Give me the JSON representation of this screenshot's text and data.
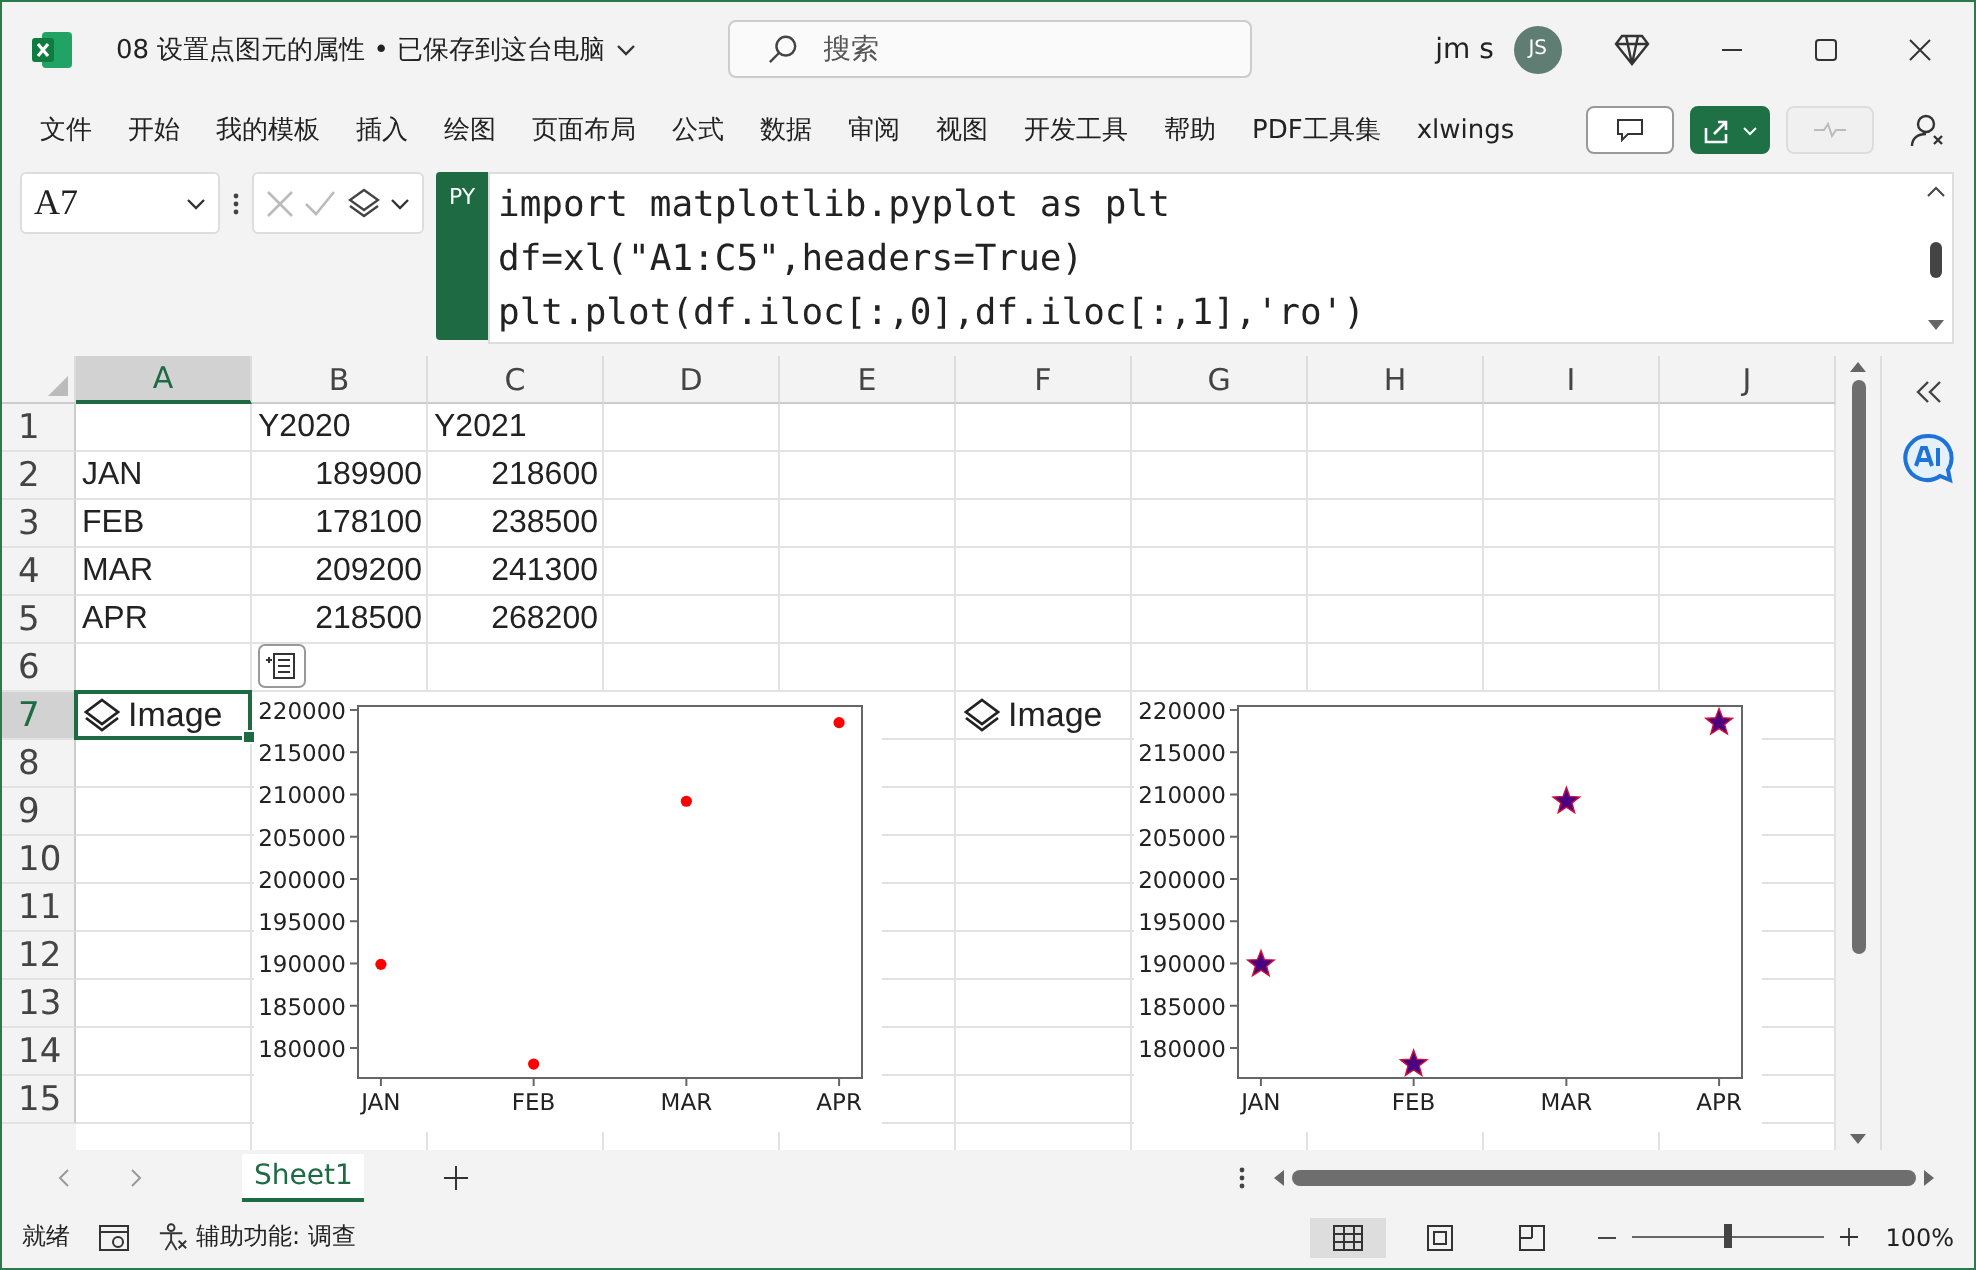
{
  "window": {
    "title": "08 设置点图元的属性 • 已保存到这台电脑",
    "search": {
      "placeholder": "搜索"
    },
    "user": "jm s",
    "avatar": "JS"
  },
  "ribbon_tabs": [
    "文件",
    "开始",
    "我的模板",
    "插入",
    "绘图",
    "页面布局",
    "公式",
    "数据",
    "审阅",
    "视图",
    "开发工具",
    "帮助",
    "PDF工具集",
    "xlwings"
  ],
  "name_box": "A7",
  "formula": {
    "badge": "PY",
    "lines": [
      "import matplotlib.pyplot as plt",
      "df=xl(\"A1:C5\",headers=True)",
      "plt.plot(df.iloc[:,0],df.iloc[:,1],'ro')"
    ]
  },
  "sheet": {
    "columns": [
      {
        "label": "A",
        "selected": true
      },
      {
        "label": "B",
        "selected": false
      },
      {
        "label": "C",
        "selected": false
      },
      {
        "label": "D",
        "selected": false
      },
      {
        "label": "E",
        "selected": false
      },
      {
        "label": "F",
        "selected": false
      },
      {
        "label": "G",
        "selected": false
      },
      {
        "label": "H",
        "selected": false
      },
      {
        "label": "I",
        "selected": false
      },
      {
        "label": "J",
        "selected": false
      }
    ],
    "rows": [
      {
        "header": "1",
        "selected": false,
        "cells": [
          {
            "kind": "empty"
          },
          {
            "kind": "text",
            "text": "Y2020"
          },
          {
            "kind": "text",
            "text": "Y2021"
          }
        ]
      },
      {
        "header": "2",
        "selected": false,
        "cells": [
          {
            "kind": "text",
            "text": "JAN"
          },
          {
            "kind": "number",
            "text": "189900"
          },
          {
            "kind": "number",
            "text": "218600"
          }
        ]
      },
      {
        "header": "3",
        "selected": false,
        "cells": [
          {
            "kind": "text",
            "text": "FEB"
          },
          {
            "kind": "number",
            "text": "178100"
          },
          {
            "kind": "number",
            "text": "238500"
          }
        ]
      },
      {
        "header": "4",
        "selected": false,
        "cells": [
          {
            "kind": "text",
            "text": "MAR"
          },
          {
            "kind": "number",
            "text": "209200"
          },
          {
            "kind": "number",
            "text": "241300"
          }
        ]
      },
      {
        "header": "5",
        "selected": false,
        "cells": [
          {
            "kind": "text",
            "text": "APR"
          },
          {
            "kind": "number",
            "text": "218500"
          },
          {
            "kind": "number",
            "text": "268200"
          }
        ]
      },
      {
        "header": "6",
        "selected": false,
        "cells": [
          {
            "kind": "empty"
          },
          {
            "kind": "card-icon"
          }
        ]
      },
      {
        "header": "7",
        "selected": true,
        "cells": [
          {
            "kind": "image-label",
            "text": "Image",
            "selected": true
          },
          {
            "kind": "empty"
          },
          {
            "kind": "empty"
          },
          {
            "kind": "empty"
          },
          {
            "kind": "empty"
          },
          {
            "kind": "image-label",
            "text": "Image",
            "selected": false
          }
        ]
      },
      {
        "header": "8",
        "selected": false,
        "cells": []
      },
      {
        "header": "9",
        "selected": false,
        "cells": []
      },
      {
        "header": "10",
        "selected": false,
        "cells": []
      },
      {
        "header": "11",
        "selected": false,
        "cells": []
      },
      {
        "header": "12",
        "selected": false,
        "cells": []
      },
      {
        "header": "13",
        "selected": false,
        "cells": []
      },
      {
        "header": "14",
        "selected": false,
        "cells": []
      },
      {
        "header": "15",
        "selected": false,
        "cells": []
      }
    ],
    "images": [
      {
        "chart_data": {
          "type": "scatter",
          "categories": [
            "JAN",
            "FEB",
            "MAR",
            "APR"
          ],
          "series": [
            {
              "color": "#ff0000",
              "marker": "o",
              "values": [
                189900,
                178100,
                209200,
                218500
              ]
            }
          ],
          "ylim": [
            176450,
            220470
          ],
          "yticks": [
            180000,
            185000,
            190000,
            195000,
            200000,
            205000,
            210000,
            215000,
            220000
          ]
        }
      },
      {
        "chart_data": {
          "type": "scatter",
          "categories": [
            "JAN",
            "FEB",
            "MAR",
            "APR"
          ],
          "series": [
            {
              "color": "#4b0082",
              "marker": "*",
              "values": [
                189900,
                178100,
                209200,
                218500
              ]
            }
          ],
          "ylim": [
            176450,
            220470
          ],
          "yticks": [
            180000,
            185000,
            190000,
            195000,
            200000,
            205000,
            210000,
            215000,
            220000
          ]
        }
      }
    ]
  },
  "sheet_tabs": [
    {
      "label": "Sheet1",
      "selected": true
    }
  ],
  "status_bar": {
    "ready": "就绪",
    "accessibility": "辅助功能: 调查",
    "zoom_slider": {
      "level": 0.5
    },
    "zoom": "100%"
  }
}
